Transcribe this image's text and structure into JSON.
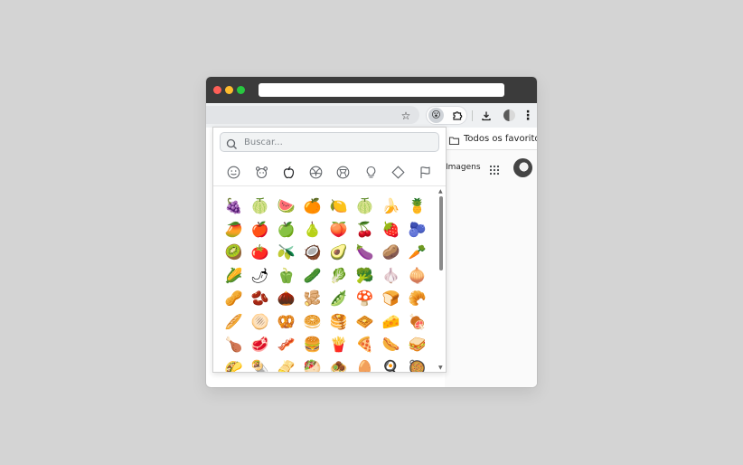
{
  "window": {
    "bookmark_folder": "Todos os favoritos",
    "images_link": "Imagens"
  },
  "toolbar": {
    "star_icon": "☆",
    "extension_icon": "😮",
    "puzzle_icon": "⧉",
    "download_icon": "⤓",
    "menu_icon": "⋮"
  },
  "picker": {
    "search_placeholder": "Buscar...",
    "categories": [
      "smiley",
      "animals",
      "food",
      "activities",
      "travel",
      "objects",
      "symbols",
      "flags"
    ],
    "active_category": "food",
    "emojis": [
      "🍇",
      "🍈",
      "🍉",
      "🍊",
      "🍋",
      "🍈",
      "🍌",
      "🍍",
      "🥭",
      "🍎",
      "🍏",
      "🍐",
      "🍑",
      "🍒",
      "🍓",
      "🫐",
      "🥝",
      "🍅",
      "🫒",
      "🥥",
      "🥑",
      "🍆",
      "🥔",
      "🥕",
      "🌽",
      "🌶",
      "🫑",
      "🥒",
      "🥬",
      "🥦",
      "🧄",
      "🧅",
      "🥜",
      "🫘",
      "🌰",
      "🫚",
      "🫛",
      "🍄",
      "🍞",
      "🥐",
      "🥖",
      "🫓",
      "🥨",
      "🥯",
      "🥞",
      "🧇",
      "🧀",
      "🍖",
      "🍗",
      "🥩",
      "🥓",
      "🍔",
      "🍟",
      "🍕",
      "🌭",
      "🥪",
      "🌮",
      "🌯",
      "🫔",
      "🥙",
      "🧆",
      "🥚",
      "🍳",
      "🥘"
    ]
  }
}
